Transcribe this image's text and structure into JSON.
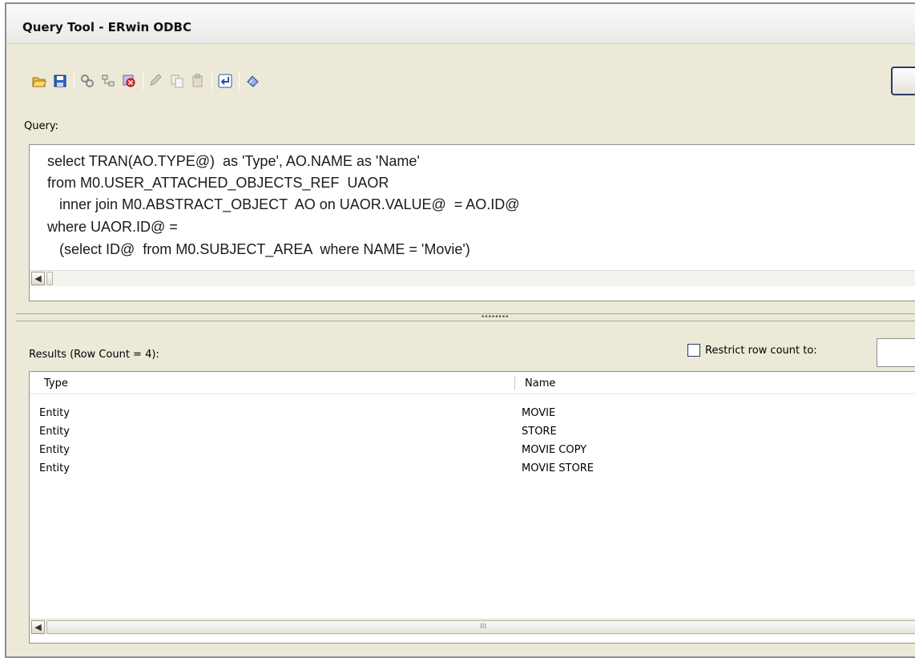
{
  "window": {
    "title": "Query Tool - ERwin ODBC"
  },
  "toolbar": {
    "icons": [
      "open-icon",
      "save-icon",
      "connect-icon",
      "tree-icon",
      "disconnect-icon",
      "edit-icon",
      "copy-icon",
      "paste-icon",
      "execute-icon",
      "clear-icon"
    ]
  },
  "query": {
    "label": "Query:",
    "lines": [
      "select TRAN(AO.TYPE@)  as 'Type', AO.NAME as 'Name'",
      "from M0.USER_ATTACHED_OBJECTS_REF  UAOR",
      "   inner join M0.ABSTRACT_OBJECT  AO on UAOR.VALUE@  = AO.ID@",
      "where UAOR.ID@ =",
      "   (select ID@  from M0.SUBJECT_AREA  where NAME = 'Movie')"
    ]
  },
  "results": {
    "label": "Results (Row Count = 4):",
    "restrict_label": "Restrict row count to:",
    "restrict_checked": false,
    "columns": [
      "Type",
      "Name"
    ],
    "rows": [
      [
        "Entity",
        "MOVIE"
      ],
      [
        "Entity",
        "STORE"
      ],
      [
        "Entity",
        "MOVIE COPY"
      ],
      [
        "Entity",
        "MOVIE STORE"
      ]
    ]
  },
  "scroll": {
    "left_arrow": "◀",
    "thumb_grip": "III"
  }
}
